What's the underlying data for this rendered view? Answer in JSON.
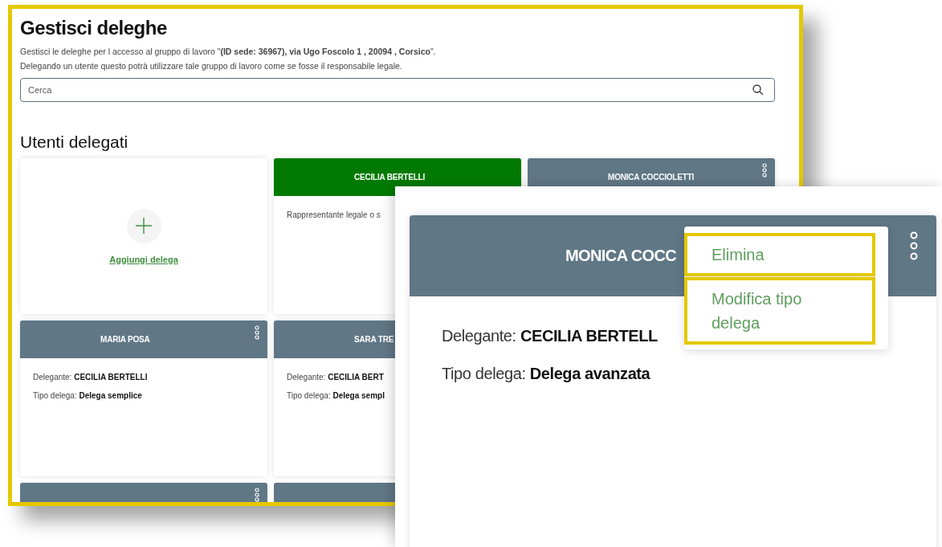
{
  "page": {
    "title": "Gestisci deleghe",
    "intro": "Gestisci le deleghe per l accesso al gruppo di lavoro \"**(ID sede: 36967), via Ugo Foscolo 1 , 20094 , Corsico**\".",
    "note": "Delegando un utente questo potrà utilizzare tale gruppo di lavoro come se fosse il responsabile legale.",
    "search": {
      "placeholder": "Cerca"
    },
    "section_title": "Utenti delegati",
    "card_rows": [
      [
        {
          "kind": "add",
          "label": "Aggiungi delega"
        },
        {
          "kind": "owner",
          "name": "CECILIA BERTELLI",
          "menu": false,
          "lines": [
            "Rappresentante legale o s"
          ]
        },
        {
          "kind": "delegate",
          "name": "MONICA COCCIOLETTI",
          "menu": true
        }
      ],
      [
        {
          "kind": "delegate",
          "name": "MARIA POSA",
          "menu": true,
          "lines": [
            "Delegante: **CECILIA BERTELLI**",
            "Tipo delega: **Delega semplice**"
          ]
        },
        {
          "kind": "delegate",
          "name": "SARA TRE",
          "menu": false,
          "lines": [
            "Delegante: **CECILIA BERT**",
            "Tipo delega: **Delega sempl**"
          ]
        }
      ],
      [
        {
          "kind": "strip",
          "menu": true
        },
        {
          "kind": "strip",
          "menu": false
        }
      ]
    ]
  },
  "zoom": {
    "card": {
      "kind": "delegate",
      "name": "MONICA COCC",
      "menu": true,
      "lines": [
        "Delegante: **CECILIA BERTELL**",
        "Tipo delega: **Delega avanzata**"
      ]
    },
    "menu": [
      {
        "label": "Elimina",
        "highlighted": true
      },
      {
        "label": "Modifica tipo delega",
        "highlighted": true
      }
    ]
  }
}
